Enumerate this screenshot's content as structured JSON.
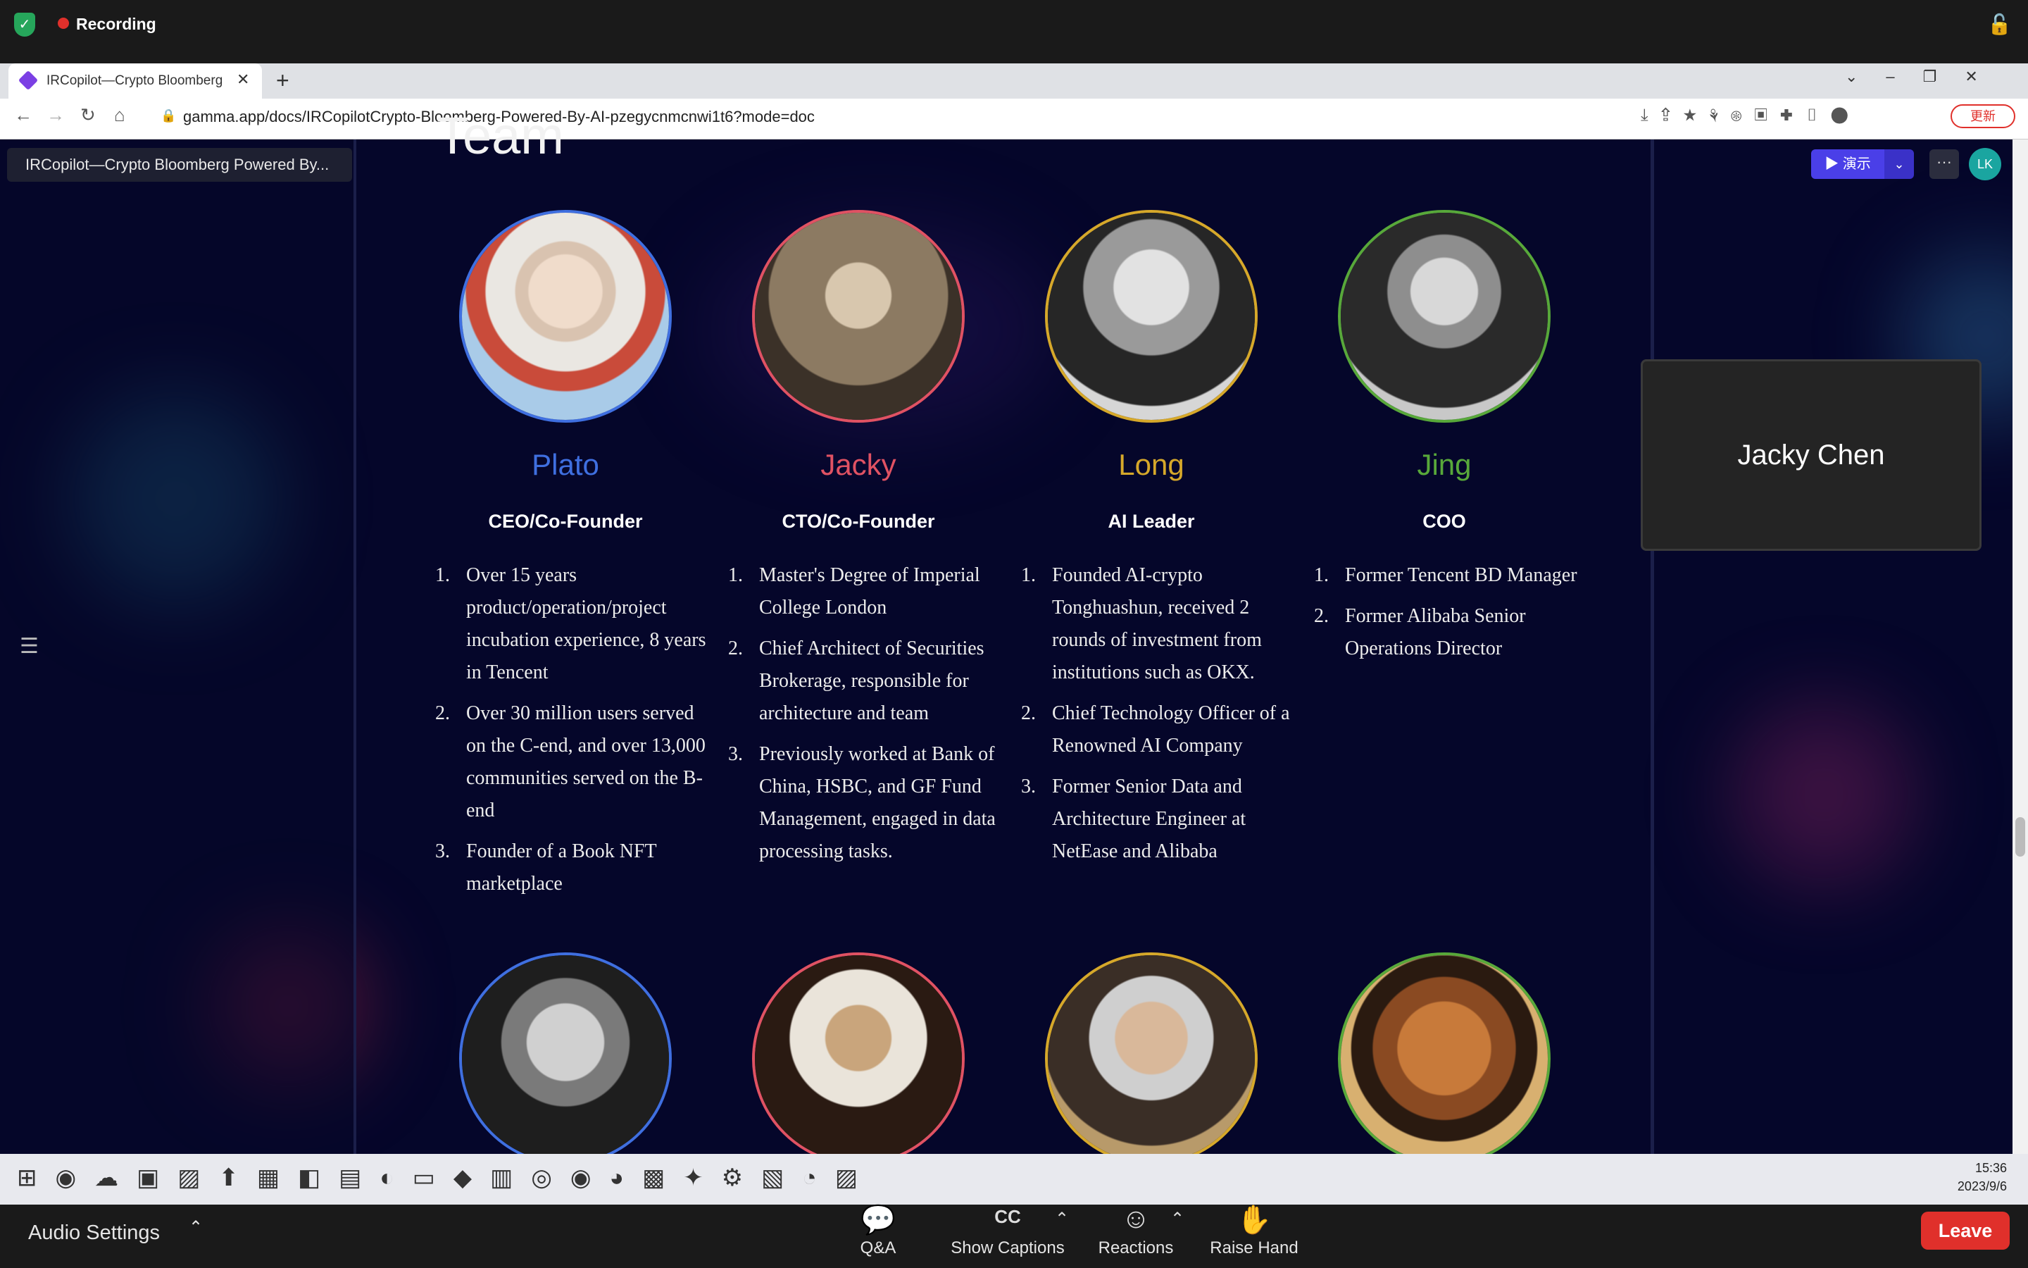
{
  "zoom_top": {
    "recording_label": "Recording"
  },
  "browser": {
    "tab_title": "IRCopilot—Crypto Bloomberg",
    "url": "gamma.app/docs/IRCopilotCrypto-Bloomberg-Powered-By-AI-pzegycnmcnwi1t6?mode=doc",
    "update_label": "更新"
  },
  "doc": {
    "title_chip": "IRCopilot—Crypto Bloomberg Powered By...",
    "heading": "Team",
    "present_label": "演示",
    "avatar_initials": "LK"
  },
  "team": [
    {
      "name": "Plato",
      "color": "#3f6fe0",
      "role": "CEO/Co-Founder",
      "bullets": [
        "Over 15 years product/operation/project incubation experience, 8 years in Tencent",
        "Over 30 million users served on the C-end, and over 13,000 communities served on the B-end",
        "Founder of a Book NFT marketplace"
      ]
    },
    {
      "name": "Jacky",
      "color": "#e05263",
      "role": "CTO/Co-Founder",
      "bullets": [
        "Master's Degree of Imperial College London",
        "Chief Architect of Securities Brokerage, responsible for architecture and team",
        "Previously worked at Bank of China, HSBC, and GF Fund Management, engaged in data processing tasks."
      ]
    },
    {
      "name": "Long",
      "color": "#d6a82a",
      "role": "AI Leader",
      "bullets": [
        "Founded AI-crypto Tonghuashun, received 2 rounds of investment from institutions such as OKX.",
        "Chief Technology Officer of a Renowned AI Company",
        "Former Senior Data and Architecture Engineer at NetEase and Alibaba"
      ]
    },
    {
      "name": "Jing",
      "color": "#58a83a",
      "role": "COO",
      "bullets": [
        "Former Tencent BD Manager",
        "Former Alibaba Senior Operations Director"
      ]
    }
  ],
  "participant": {
    "name": "Jacky Chen"
  },
  "taskbar": {
    "time": "15:36",
    "date": "2023/9/6"
  },
  "zoom_bottom": {
    "audio_settings": "Audio Settings",
    "qa": "Q&A",
    "captions": "Show Captions",
    "captions_icon": "CC",
    "reactions": "Reactions",
    "raise_hand": "Raise Hand",
    "leave": "Leave"
  }
}
